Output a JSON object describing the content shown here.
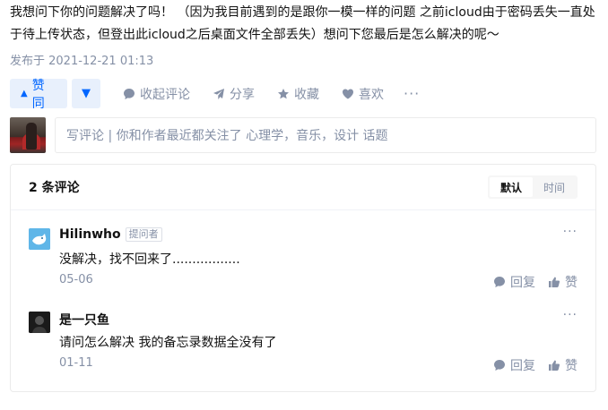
{
  "answer": {
    "text": "我想问下你的问题解决了吗！ （因为我目前遇到的是跟你一模一样的问题 之前icloud由于密码丢失一直处于待上传状态，但登出此icloud之后桌面文件全部丢失）想问下您最后是怎么解决的呢～",
    "publish_time": "发布于 2021-12-21 01:13"
  },
  "actions": {
    "vote_up": "赞同",
    "collapse_comments": "收起评论",
    "share": "分享",
    "favorite": "收藏",
    "like": "喜欢",
    "more": "···"
  },
  "editor": {
    "placeholder": "写评论 | 你和作者最近都关注了 心理学，音乐，设计 话题"
  },
  "comments": {
    "count_label": "2 条评论",
    "sort": {
      "default": "默认",
      "time": "时间"
    },
    "items": [
      {
        "author": "Hilinwho",
        "tag": "提问者",
        "content": "没解决，找不回来了.................",
        "date": "05-06",
        "reply": "回复",
        "like": "赞",
        "more": "···"
      },
      {
        "author": "是一只鱼",
        "content": "请问怎么解决 我的备忘录数据全没有了",
        "date": "01-11",
        "reply": "回复",
        "like": "赞",
        "more": "···"
      }
    ]
  },
  "colors": {
    "accent": "#0066ff",
    "accent_bg": "#e8f0fc",
    "muted": "#8590a6"
  }
}
